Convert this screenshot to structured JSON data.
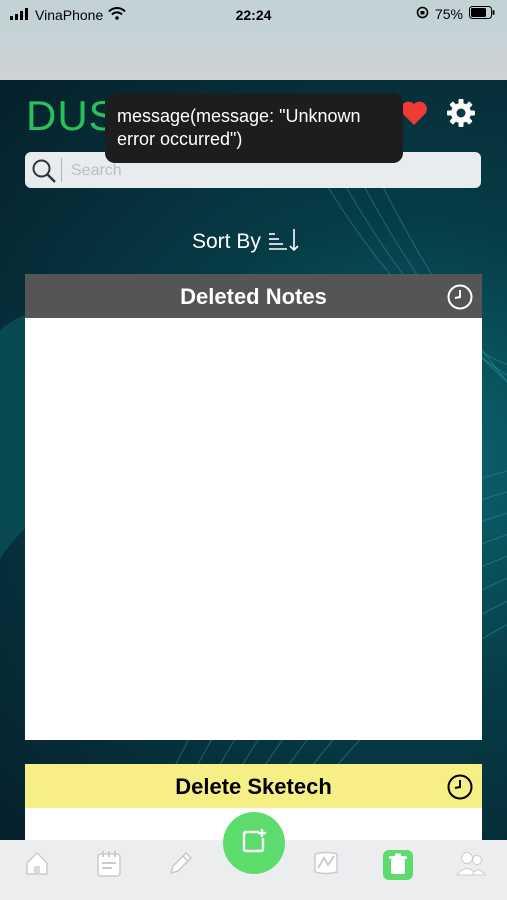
{
  "status_bar": {
    "carrier": "VinaPhone",
    "time": "22:24",
    "battery": "75%"
  },
  "header": {
    "title": "DUST BIN"
  },
  "search": {
    "placeholder": "Search"
  },
  "sort": {
    "label": "Sort By"
  },
  "sections": {
    "deleted_notes": {
      "title": "Deleted Notes"
    },
    "delete_sketch": {
      "title": "Delete Sketech"
    }
  },
  "toast": {
    "message": "message(message: \"Unknown error occurred\")"
  },
  "colors": {
    "accent_green": "#27c35a",
    "fab_green": "#5bdc6d",
    "notes_header": "#555555",
    "sketch_header": "#f5ef85",
    "heart_red": "#ef3b36"
  },
  "tab_bar": {
    "tabs": [
      {
        "icon": "home-icon",
        "active": false
      },
      {
        "icon": "notepad-icon",
        "active": false
      },
      {
        "icon": "pencil-icon",
        "active": false
      },
      {
        "icon": "sketch-icon",
        "active": false
      },
      {
        "icon": "trash-icon",
        "active": true
      },
      {
        "icon": "users-icon",
        "active": false
      }
    ]
  }
}
